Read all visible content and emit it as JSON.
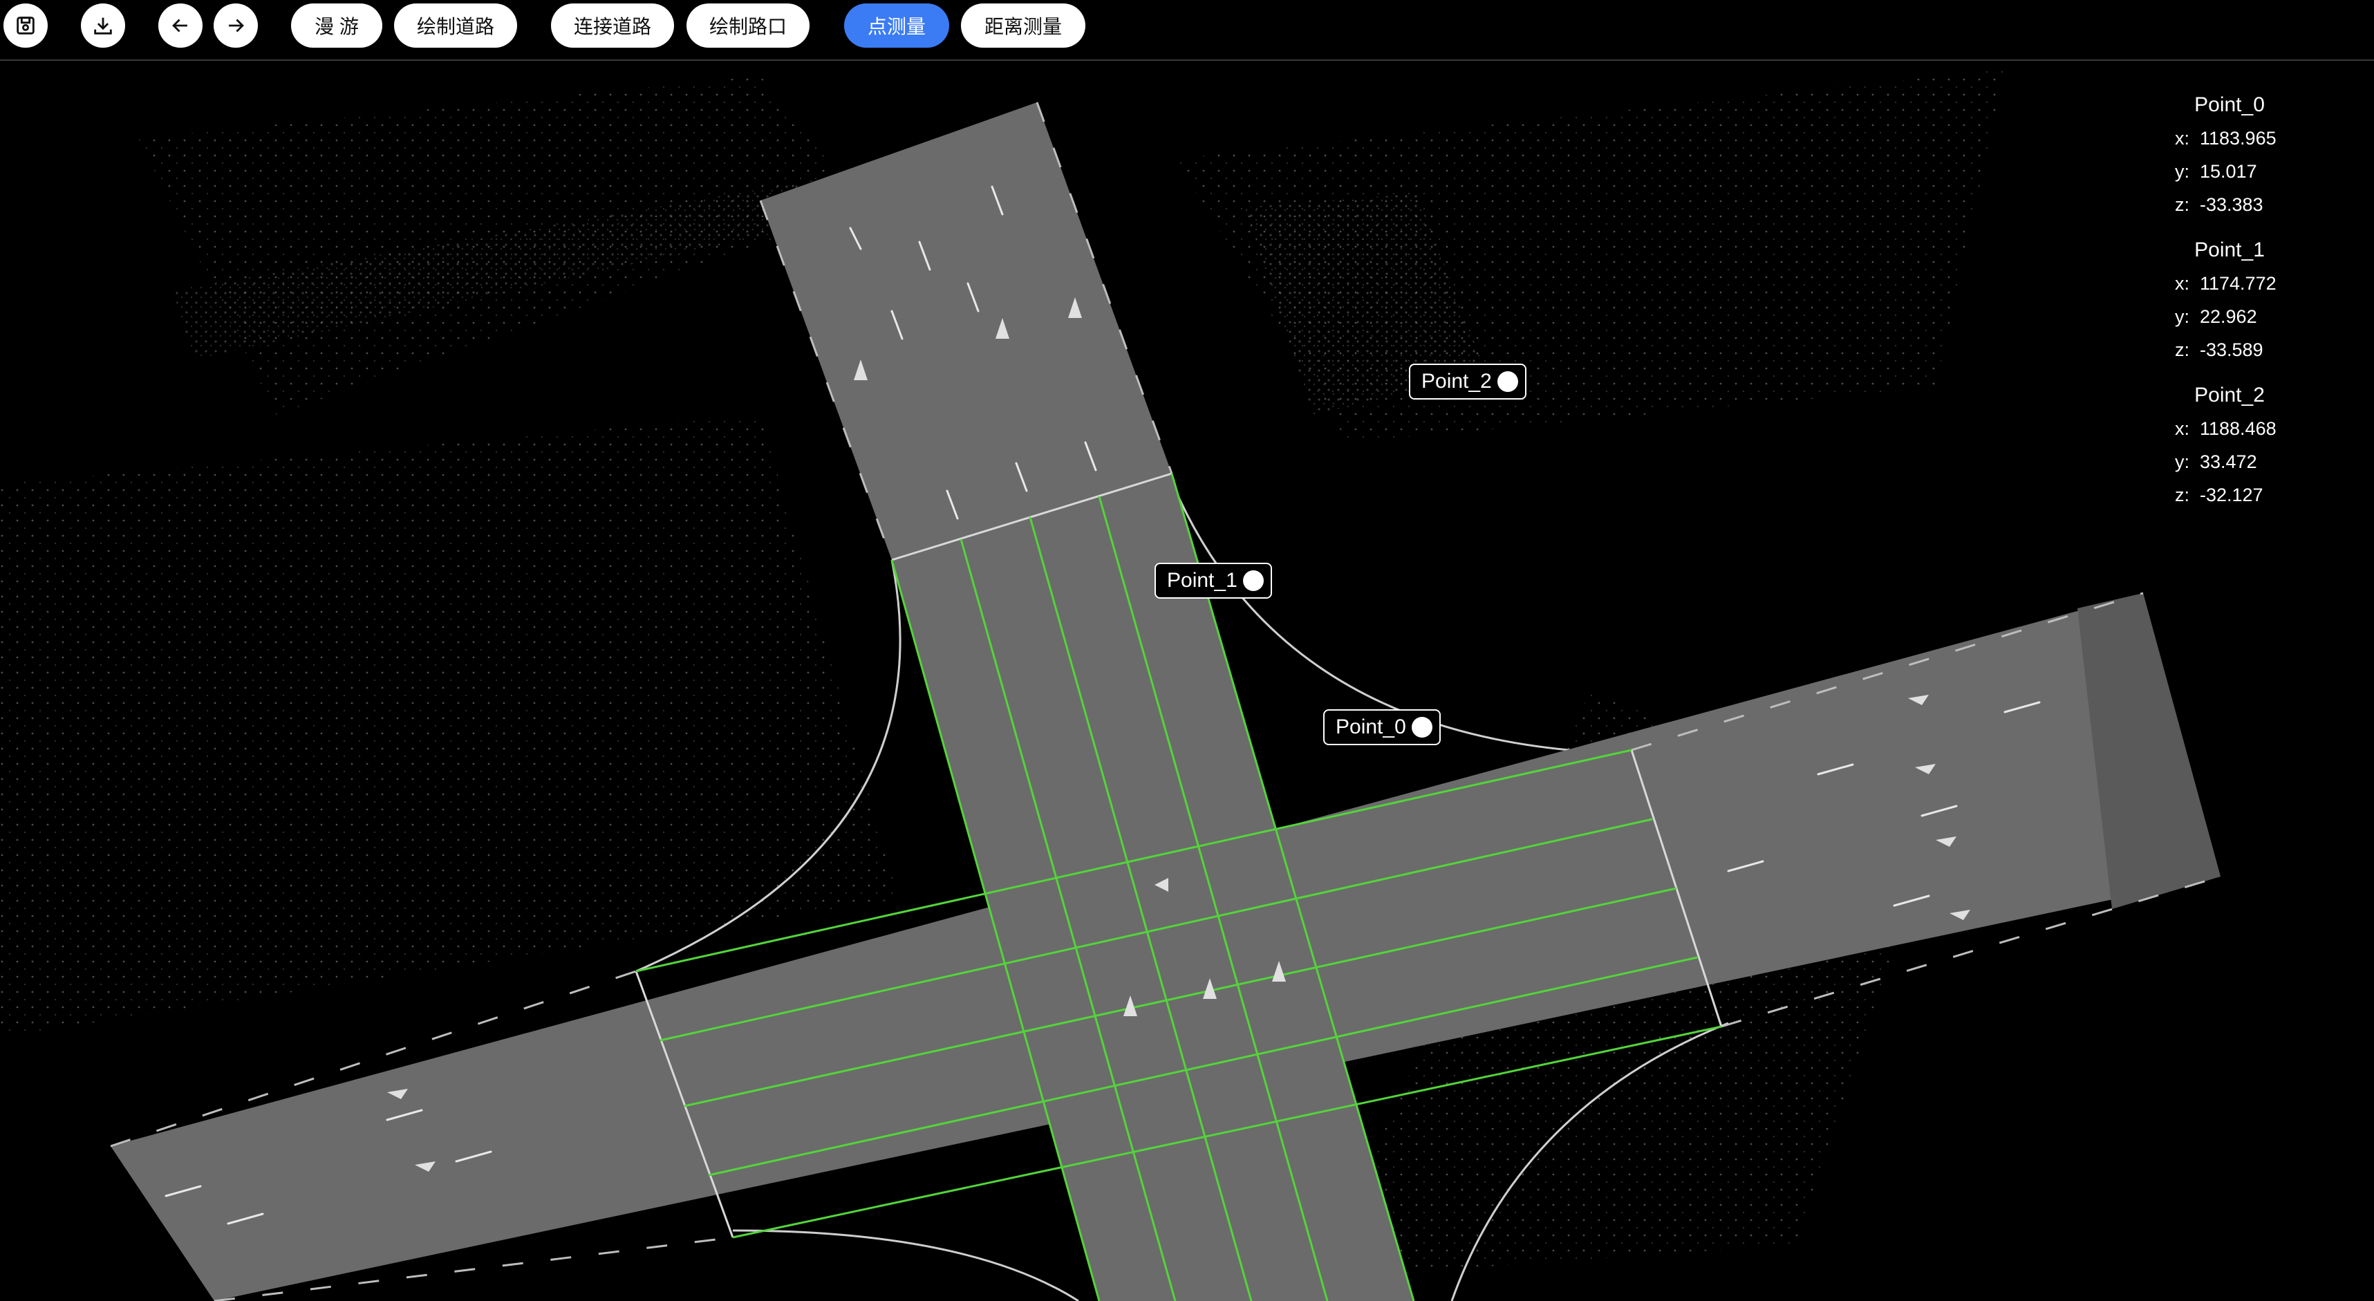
{
  "toolbar": {
    "roam_label": "漫 游",
    "draw_road_label": "绘制道路",
    "connect_road_label": "连接道路",
    "draw_intersection_label": "绘制路口",
    "point_measure_label": "点测量",
    "distance_measure_label": "距离测量",
    "icons": [
      "save-icon",
      "download-icon",
      "undo-arrow-icon",
      "redo-arrow-icon"
    ],
    "active_tool": "point_measure",
    "accent_color": "#3b7cf5"
  },
  "map_labels": [
    {
      "name": "Point_2"
    },
    {
      "name": "Point_1"
    },
    {
      "name": "Point_0"
    }
  ],
  "coordinates": [
    {
      "name": "Point_0",
      "x_label": "x:",
      "x": "1183.965",
      "y_label": "y:",
      "y": "15.017",
      "z_label": "z:",
      "z": "-33.383"
    },
    {
      "name": "Point_1",
      "x_label": "x:",
      "x": "1174.772",
      "y_label": "y:",
      "y": "22.962",
      "z_label": "z:",
      "z": "-33.589"
    },
    {
      "name": "Point_2",
      "x_label": "x:",
      "x": "1188.468",
      "y_label": "y:",
      "y": "33.472",
      "z_label": "z:",
      "z": "-32.127"
    }
  ],
  "colors": {
    "road_fill": "#6b6b6b",
    "lane_line": "#53d43a",
    "boundary_line": "#cfcfcf",
    "background": "#000000"
  }
}
